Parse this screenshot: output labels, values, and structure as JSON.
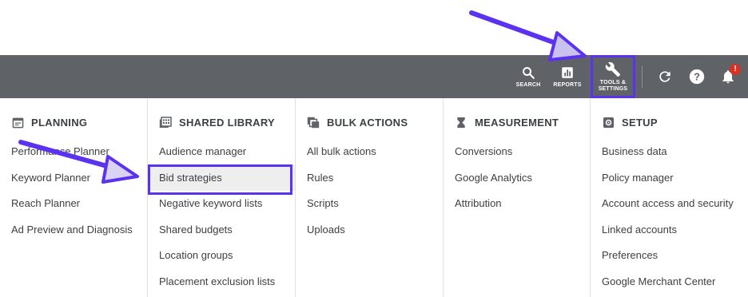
{
  "topbar": {
    "search_label": "SEARCH",
    "reports_label": "REPORTS",
    "tools_label": "TOOLS &\nSETTINGS",
    "notification_count": "!"
  },
  "columns": [
    {
      "title": "PLANNING",
      "icon": "calendar-icon",
      "items": [
        "Performance Planner",
        "Keyword Planner",
        "Reach Planner",
        "Ad Preview and Diagnosis"
      ]
    },
    {
      "title": "SHARED LIBRARY",
      "icon": "library-icon",
      "items": [
        "Audience manager",
        "Bid strategies",
        "Negative keyword lists",
        "Shared budgets",
        "Location groups",
        "Placement exclusion lists"
      ]
    },
    {
      "title": "BULK ACTIONS",
      "icon": "copy-icon",
      "items": [
        "All bulk actions",
        "Rules",
        "Scripts",
        "Uploads"
      ]
    },
    {
      "title": "MEASUREMENT",
      "icon": "hourglass-icon",
      "items": [
        "Conversions",
        "Google Analytics",
        "Attribution"
      ]
    },
    {
      "title": "SETUP",
      "icon": "settings-icon",
      "items": [
        "Business data",
        "Policy manager",
        "Account access and security",
        "Linked accounts",
        "Preferences",
        "Google Merchant Center"
      ]
    }
  ],
  "colors": {
    "topbar": "#5f6368",
    "highlight": "#5b32f0",
    "badge": "#d93025"
  }
}
